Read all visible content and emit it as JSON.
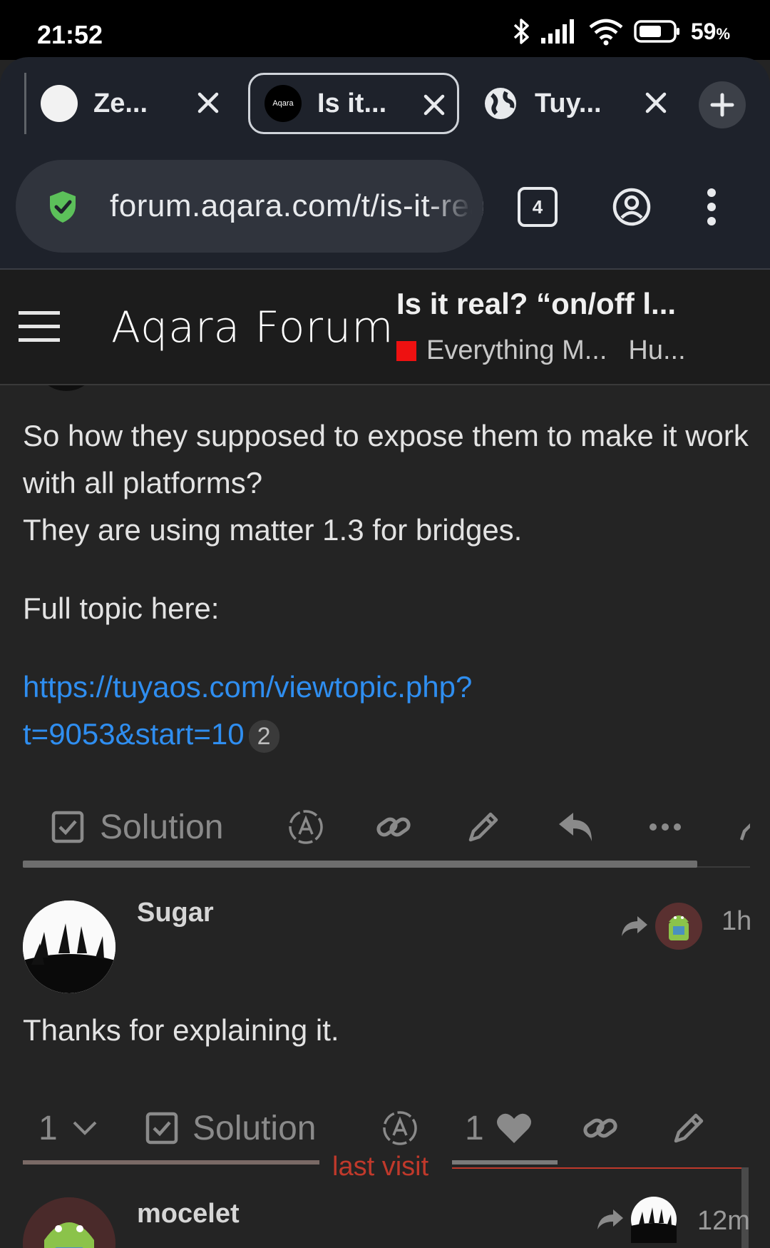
{
  "status_bar": {
    "time": "21:52",
    "battery_percent": "59",
    "battery_suffix": "%",
    "icons": [
      "bluetooth-icon",
      "signal-icon",
      "wifi-icon",
      "battery-icon"
    ]
  },
  "browser": {
    "tabs": [
      {
        "title": "Ze...",
        "favicon": "white-circle"
      },
      {
        "title": "Is it...",
        "favicon": "aqara-logo",
        "active": true,
        "favicon_text": "Aqara"
      },
      {
        "title": "Tuy...",
        "favicon": "globe-icon"
      }
    ],
    "url": "forum.aqara.com/t/is-it-real",
    "tab_count": "4",
    "colors": {
      "secure_shield": "#5cc05a",
      "chrome_bg": "#1e222b"
    }
  },
  "forum": {
    "logo": "Aqara Forum",
    "topic_title": "Is it real? “on/off l...",
    "category": "Everything M...",
    "category_color": "#ee1111",
    "tag": "Hu..."
  },
  "post1": {
    "paragraphs": [
      "So how they supposed to expose them to make it work with all platforms?",
      "They are using matter 1.3 for bridges."
    ],
    "full_topic": "Full topic here:",
    "link_line1": "https://tuyaos.com/viewtopic.php?",
    "link_line2": "t=9053&start=10",
    "link_clicks": "2",
    "actions": {
      "solution": "Solution"
    }
  },
  "post2": {
    "username": "Sugar",
    "time_ago": "1h",
    "body": "Thanks for explaining it.",
    "actions": {
      "replies": "1",
      "solution": "Solution",
      "likes": "1"
    }
  },
  "divider": {
    "label": "last visit"
  },
  "post3": {
    "username": "mocelet",
    "time_ago": "12m"
  }
}
